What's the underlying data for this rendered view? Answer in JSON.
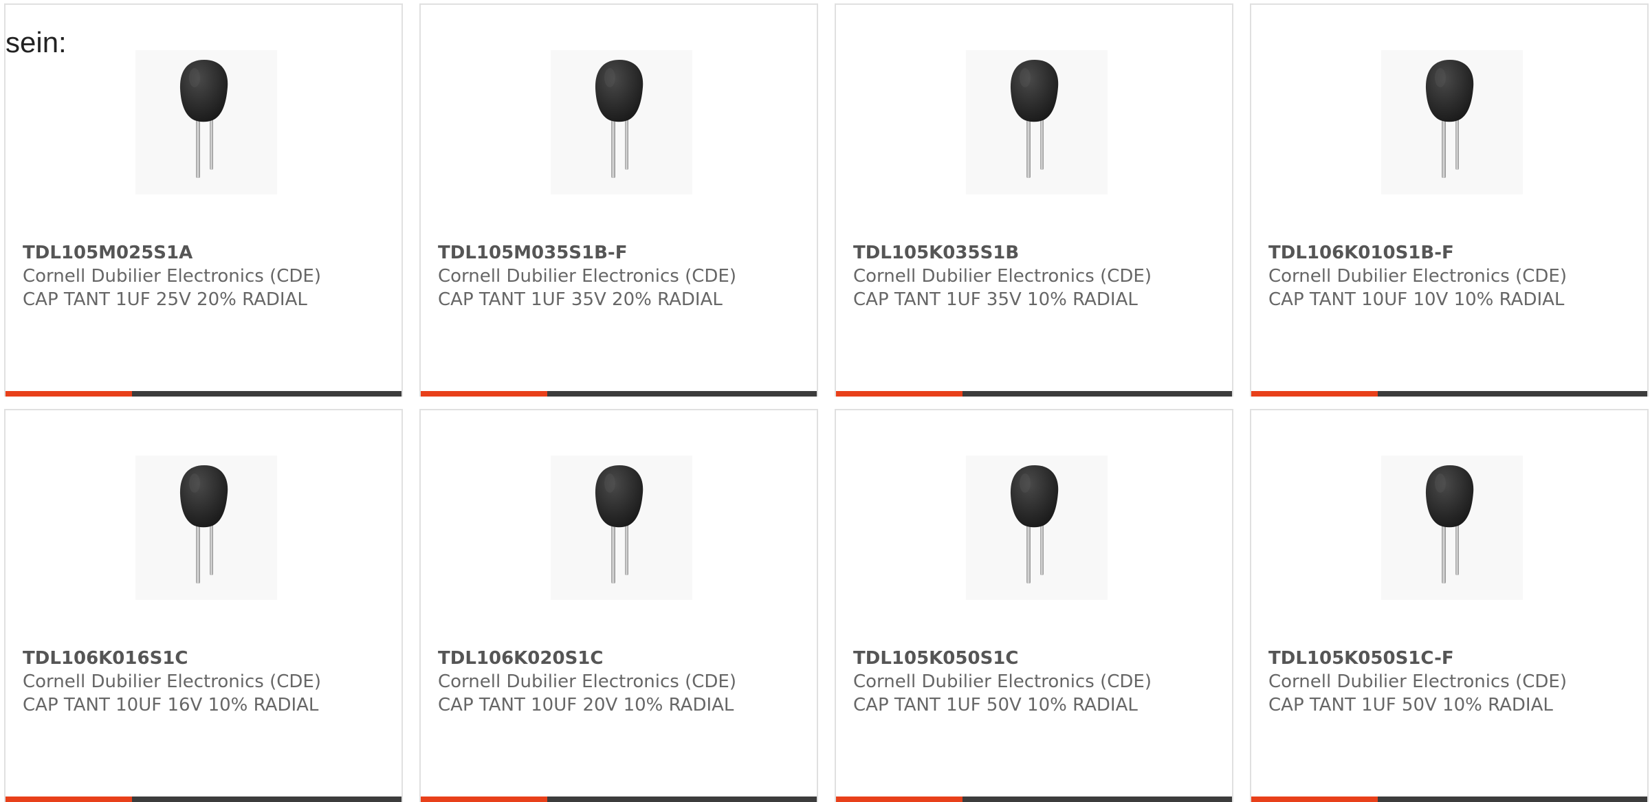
{
  "intro_text": "sein:",
  "colors": {
    "accent": "#e8401a",
    "bar": "#3c3c3c",
    "border": "#e0e0e0"
  },
  "accent_fraction": 0.32,
  "products": [
    {
      "part_number": "TDL105M025S1A",
      "manufacturer": "Cornell Dubilier Electronics (CDE)",
      "description": "CAP TANT 1UF 25V 20% RADIAL",
      "image_icon": "radial-capacitor-icon"
    },
    {
      "part_number": "TDL105M035S1B-F",
      "manufacturer": "Cornell Dubilier Electronics (CDE)",
      "description": "CAP TANT 1UF 35V 20% RADIAL",
      "image_icon": "radial-capacitor-icon"
    },
    {
      "part_number": "TDL105K035S1B",
      "manufacturer": "Cornell Dubilier Electronics (CDE)",
      "description": "CAP TANT 1UF 35V 10% RADIAL",
      "image_icon": "radial-capacitor-icon"
    },
    {
      "part_number": "TDL106K010S1B-F",
      "manufacturer": "Cornell Dubilier Electronics (CDE)",
      "description": "CAP TANT 10UF 10V 10% RADIAL",
      "image_icon": "radial-capacitor-icon"
    },
    {
      "part_number": "TDL106K016S1C",
      "manufacturer": "Cornell Dubilier Electronics (CDE)",
      "description": "CAP TANT 10UF 16V 10% RADIAL",
      "image_icon": "radial-capacitor-icon"
    },
    {
      "part_number": "TDL106K020S1C",
      "manufacturer": "Cornell Dubilier Electronics (CDE)",
      "description": "CAP TANT 10UF 20V 10% RADIAL",
      "image_icon": "radial-capacitor-icon"
    },
    {
      "part_number": "TDL105K050S1C",
      "manufacturer": "Cornell Dubilier Electronics (CDE)",
      "description": "CAP TANT 1UF 50V 10% RADIAL",
      "image_icon": "radial-capacitor-icon"
    },
    {
      "part_number": "TDL105K050S1C-F",
      "manufacturer": "Cornell Dubilier Electronics (CDE)",
      "description": "CAP TANT 1UF 50V 10% RADIAL",
      "image_icon": "radial-capacitor-icon"
    }
  ]
}
